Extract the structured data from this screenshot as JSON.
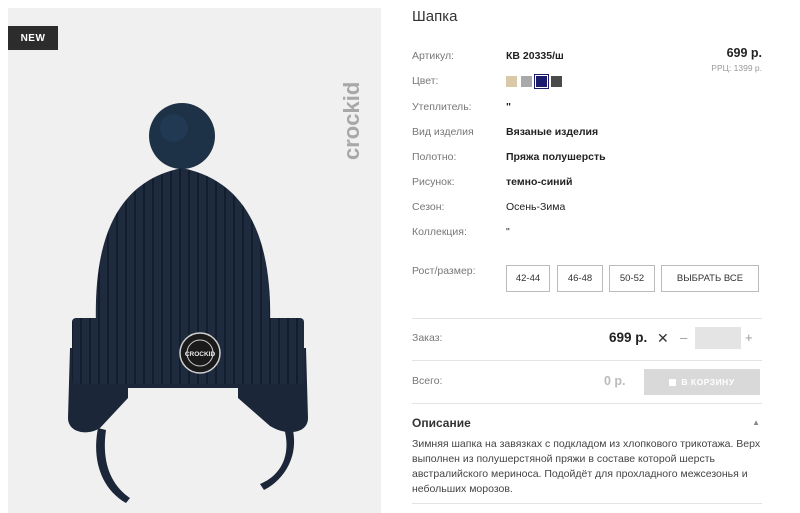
{
  "badge": "NEW",
  "brand": "crockid",
  "patch_text": "CROCKID",
  "title": "Шапка",
  "price": "699 р.",
  "rrp": "РРЦ: 1399 р.",
  "fields": [
    {
      "label": "Артикул:",
      "value": "КВ 20335/ш",
      "bold": true
    },
    {
      "label": "Цвет:",
      "value": "",
      "bold": false
    },
    {
      "label": "Утеплитель:",
      "value": "\"",
      "bold": true
    },
    {
      "label": "Вид изделия",
      "value": "Вязаные изделия",
      "bold": true
    },
    {
      "label": "Полотно:",
      "value": "Пряжа полушерсть",
      "bold": true
    },
    {
      "label": "Рисунок:",
      "value": "темно-синий",
      "bold": true
    },
    {
      "label": "Сезон:",
      "value": "Осень-Зима",
      "bold": false
    },
    {
      "label": "Коллекция:",
      "value": "\"",
      "bold": false
    }
  ],
  "colors": [
    "#d9c9a8",
    "#a9a9a9",
    "#1b1b6b",
    "#4a4a4a"
  ],
  "selected_color_index": 2,
  "size_label": "Рост/размер:",
  "sizes": [
    "42-44",
    "46-48",
    "50-52"
  ],
  "select_all": "ВЫБРАТЬ ВСЕ",
  "order_label": "Заказ:",
  "order_price": "699 р.",
  "times": "✕",
  "minus": "–",
  "plus": "+",
  "quantity": "",
  "total_label": "Всего:",
  "total_price": "0 р.",
  "cart_button": "В КОРЗИНУ",
  "description_title": "Описание",
  "description_caret": "▲",
  "description": "Зимняя шапка на завязках с подкладом из хлопкового трикотажа. Верх выполнен из полушерстяной пряжи в составе которой шерсть австралийского мериноса. Подойдёт для прохладного межсезонья и небольших морозов."
}
